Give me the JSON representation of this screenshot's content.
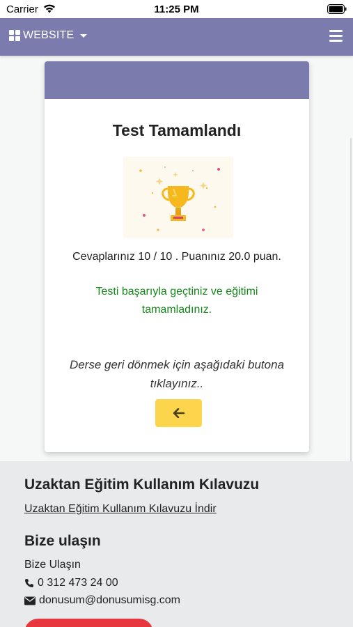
{
  "status_bar": {
    "carrier": "Carrier",
    "time": "11:25 PM"
  },
  "navbar": {
    "brand_label": "WEBSITE",
    "brand_icon": "grid-icon",
    "menu_icon": "hamburger-icon"
  },
  "result_card": {
    "title": "Test Tamamlandı",
    "image_icon": "trophy-icon",
    "score_text": "Cevaplarınız 10 / 10 . Puanınız 20.0 puan.",
    "success_text": "Testi başarıyla geçtiniz ve eğitimi tamamladınız.",
    "return_text": "Derse geri dönmek için aşağıdaki butona tıklayınız..",
    "back_button_icon": "arrow-left-icon"
  },
  "footer": {
    "guide_heading": "Uzaktan Eğitim Kullanım Kılavuzu",
    "guide_link": "Uzaktan Eğitim Kullanım Kılavuzu İndir",
    "contact_heading": "Bize ulaşın",
    "contact_label": "Bize Ulaşın",
    "phone": "0 312 473 24 00",
    "email": "donusum@donusumisg.com"
  },
  "colors": {
    "header": "#7c7bad",
    "success": "#138a1a",
    "back_button": "#fcd54c",
    "footer_bg": "#e9eaec",
    "footer_button": "#e8363f"
  }
}
